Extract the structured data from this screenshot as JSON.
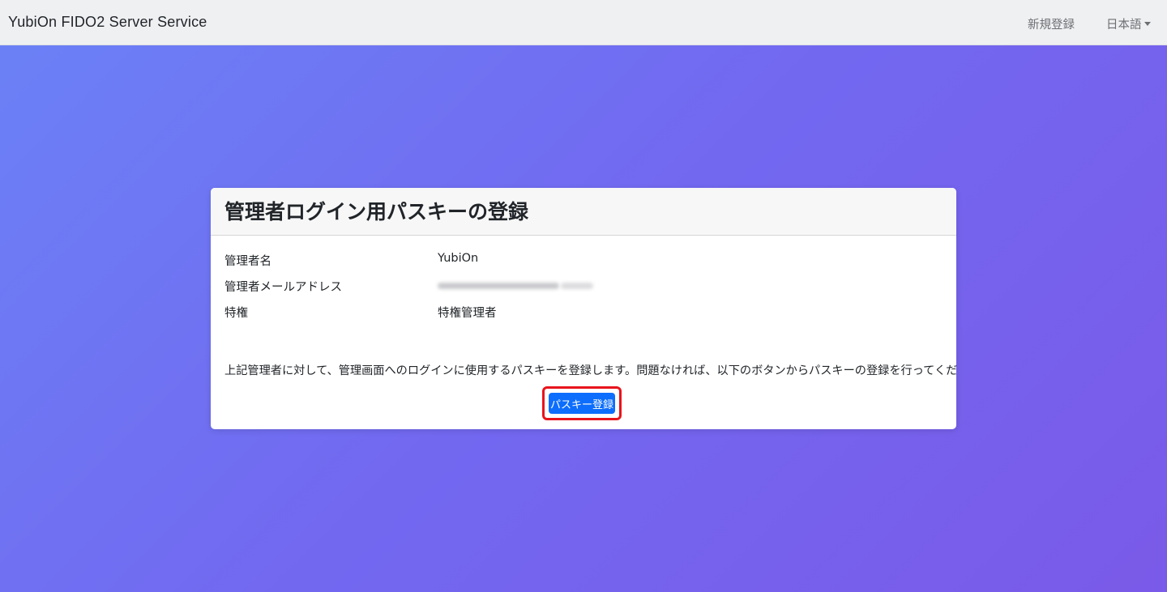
{
  "navbar": {
    "brand": "YubiOn FIDO2 Server Service",
    "register_link": "新規登録",
    "language_label": "日本語"
  },
  "card": {
    "title": "管理者ログイン用パスキーの登録",
    "fields": [
      {
        "label": "管理者名",
        "value": "YubiOn"
      },
      {
        "label": "管理者メールアドレス",
        "value": ""
      },
      {
        "label": "特権",
        "value": "特権管理者"
      }
    ],
    "message": "上記管理者に対して、管理画面へのログインに使用するパスキーを登録します。問題なければ、以下のボタンからパスキーの登録を行ってください。",
    "register_button": "パスキー登録"
  },
  "colors": {
    "primary": "#0d6efd",
    "highlight": "#e8141c",
    "background_start": "#6b82f6",
    "background_end": "#7a5ae8"
  }
}
